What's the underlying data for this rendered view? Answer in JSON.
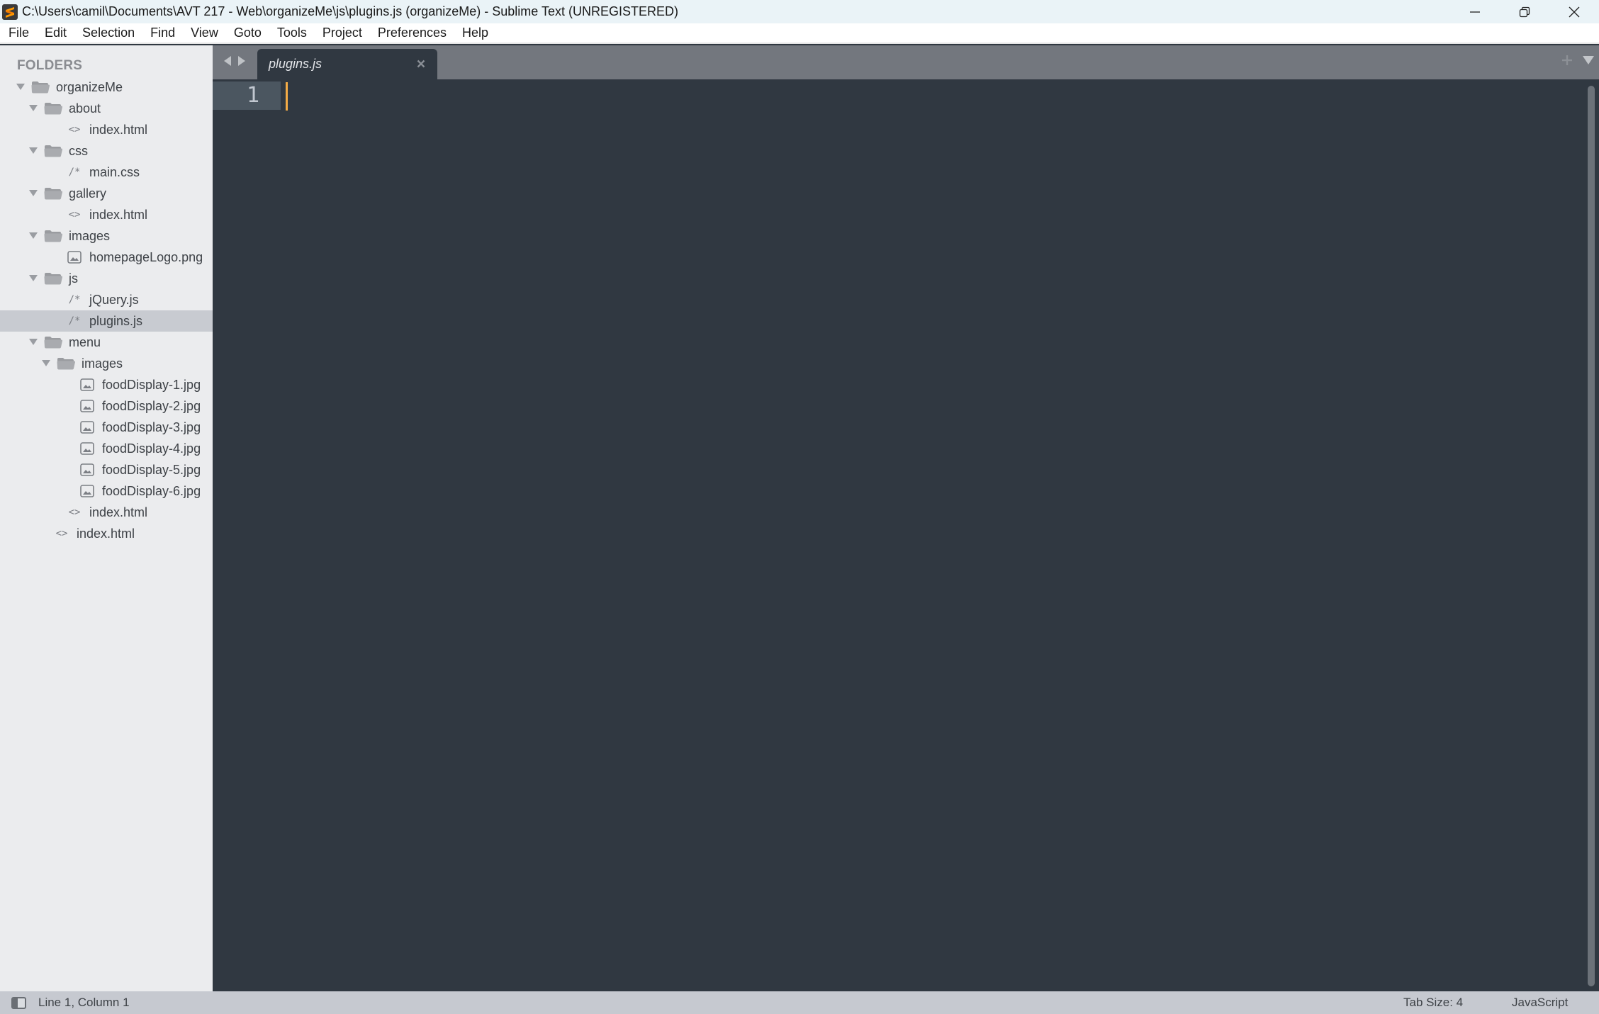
{
  "window": {
    "title": "C:\\Users\\camil\\Documents\\AVT 217 - Web\\organizeMe\\js\\plugins.js (organizeMe) - Sublime Text (UNREGISTERED)",
    "app_icon": "sublime-text-logo"
  },
  "menu": {
    "items": [
      "File",
      "Edit",
      "Selection",
      "Find",
      "View",
      "Goto",
      "Tools",
      "Project",
      "Preferences",
      "Help"
    ]
  },
  "sidebar": {
    "header": "FOLDERS",
    "tree": [
      {
        "type": "folder",
        "label": "organizeMe",
        "depth": 0,
        "expanded": true
      },
      {
        "type": "folder",
        "label": "about",
        "depth": 1,
        "expanded": true
      },
      {
        "type": "file",
        "label": "index.html",
        "depth": 2,
        "icon": "html-icon",
        "glyph": "<>"
      },
      {
        "type": "folder",
        "label": "css",
        "depth": 1,
        "expanded": true
      },
      {
        "type": "file",
        "label": "main.css",
        "depth": 2,
        "icon": "code-comment-icon",
        "glyph": "/*"
      },
      {
        "type": "folder",
        "label": "gallery",
        "depth": 1,
        "expanded": true
      },
      {
        "type": "file",
        "label": "index.html",
        "depth": 2,
        "icon": "html-icon",
        "glyph": "<>"
      },
      {
        "type": "folder",
        "label": "images",
        "depth": 1,
        "expanded": true
      },
      {
        "type": "file",
        "label": "homepageLogo.png",
        "depth": 2,
        "icon": "image-icon"
      },
      {
        "type": "folder",
        "label": "js",
        "depth": 1,
        "expanded": true
      },
      {
        "type": "file",
        "label": "jQuery.js",
        "depth": 2,
        "icon": "code-comment-icon",
        "glyph": "/*"
      },
      {
        "type": "file",
        "label": "plugins.js",
        "depth": 2,
        "icon": "code-comment-icon",
        "glyph": "/*",
        "selected": true
      },
      {
        "type": "folder",
        "label": "menu",
        "depth": 1,
        "expanded": true
      },
      {
        "type": "folder",
        "label": "images",
        "depth": 2,
        "expanded": true
      },
      {
        "type": "file",
        "label": "foodDisplay-1.jpg",
        "depth": 3,
        "icon": "image-icon"
      },
      {
        "type": "file",
        "label": "foodDisplay-2.jpg",
        "depth": 3,
        "icon": "image-icon"
      },
      {
        "type": "file",
        "label": "foodDisplay-3.jpg",
        "depth": 3,
        "icon": "image-icon"
      },
      {
        "type": "file",
        "label": "foodDisplay-4.jpg",
        "depth": 3,
        "icon": "image-icon"
      },
      {
        "type": "file",
        "label": "foodDisplay-5.jpg",
        "depth": 3,
        "icon": "image-icon"
      },
      {
        "type": "file",
        "label": "foodDisplay-6.jpg",
        "depth": 3,
        "icon": "image-icon"
      },
      {
        "type": "file",
        "label": "index.html",
        "depth": 2,
        "icon": "html-icon",
        "glyph": "<>"
      },
      {
        "type": "file",
        "label": "index.html",
        "depth": 1,
        "icon": "html-icon",
        "glyph": "<>"
      }
    ]
  },
  "tabs": [
    {
      "label": "plugins.js",
      "active": true
    }
  ],
  "editor": {
    "line_numbers": [
      "1"
    ],
    "content": "",
    "caret_color": "#f5ac46"
  },
  "status": {
    "position": "Line 1, Column 1",
    "tab_size": "Tab Size: 4",
    "syntax": "JavaScript"
  },
  "colors": {
    "editor_bg": "#303841",
    "sidebar_bg": "#ebecee",
    "tabbar_bg": "#73777e",
    "statusbar_bg": "#c6c9d0",
    "selection_bg": "#c8cbd1",
    "accent": "#f5ac46"
  }
}
